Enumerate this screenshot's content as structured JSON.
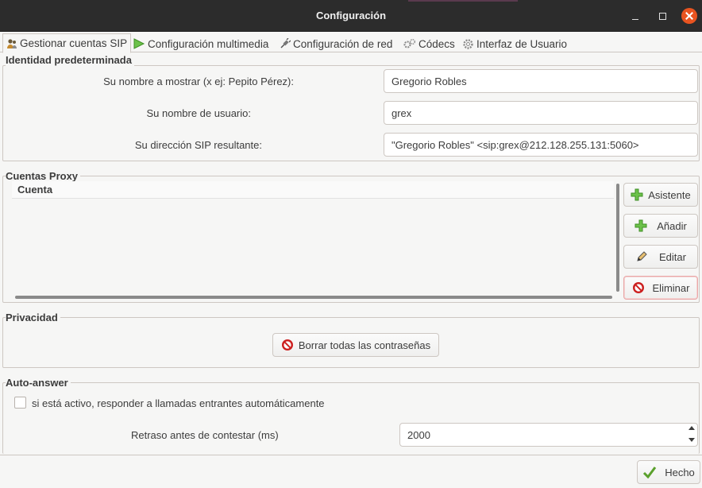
{
  "window": {
    "title": "Configuración"
  },
  "tabs": [
    {
      "label": "Gestionar cuentas SIP",
      "icon": "people-icon",
      "active": true
    },
    {
      "label": "Configuración multimedia",
      "icon": "play-icon"
    },
    {
      "label": "Configuración de red",
      "icon": "plug-icon"
    },
    {
      "label": "Códecs",
      "icon": "gears-icon"
    },
    {
      "label": "Interfaz de Usuario",
      "icon": "gear-icon"
    }
  ],
  "identity": {
    "title": "Identidad predeterminada",
    "display_name_label": "Su nombre a mostrar (x ej: Pepito Pérez):",
    "display_name_value": "Gregorio Robles",
    "username_label": "Su nombre de usuario:",
    "username_value": "grex",
    "sip_address_label": "Su dirección SIP resultante:",
    "sip_address_value": "\"Gregorio Robles\" <sip:grex@212.128.255.131:5060>"
  },
  "proxy": {
    "title": "Cuentas Proxy",
    "column_header": "Cuenta",
    "rows": [],
    "buttons": {
      "wizard": "Asistente",
      "add": "Añadir",
      "edit": "Editar",
      "delete": "Eliminar"
    }
  },
  "privacy": {
    "title": "Privacidad",
    "clear_passwords": "Borrar todas las contraseñas"
  },
  "autoanswer": {
    "title": "Auto-answer",
    "checkbox_label": "si está activo, responder a llamadas entrantes automáticamente",
    "checked": false,
    "delay_label": "Retraso antes de contestar (ms)",
    "delay_value": "2000"
  },
  "footer": {
    "done": "Hecho"
  },
  "colors": {
    "close": "#e95420",
    "titlebar": "#2c2c2c",
    "add_green": "#5aa02c",
    "delete_red": "#cc1f1f"
  }
}
